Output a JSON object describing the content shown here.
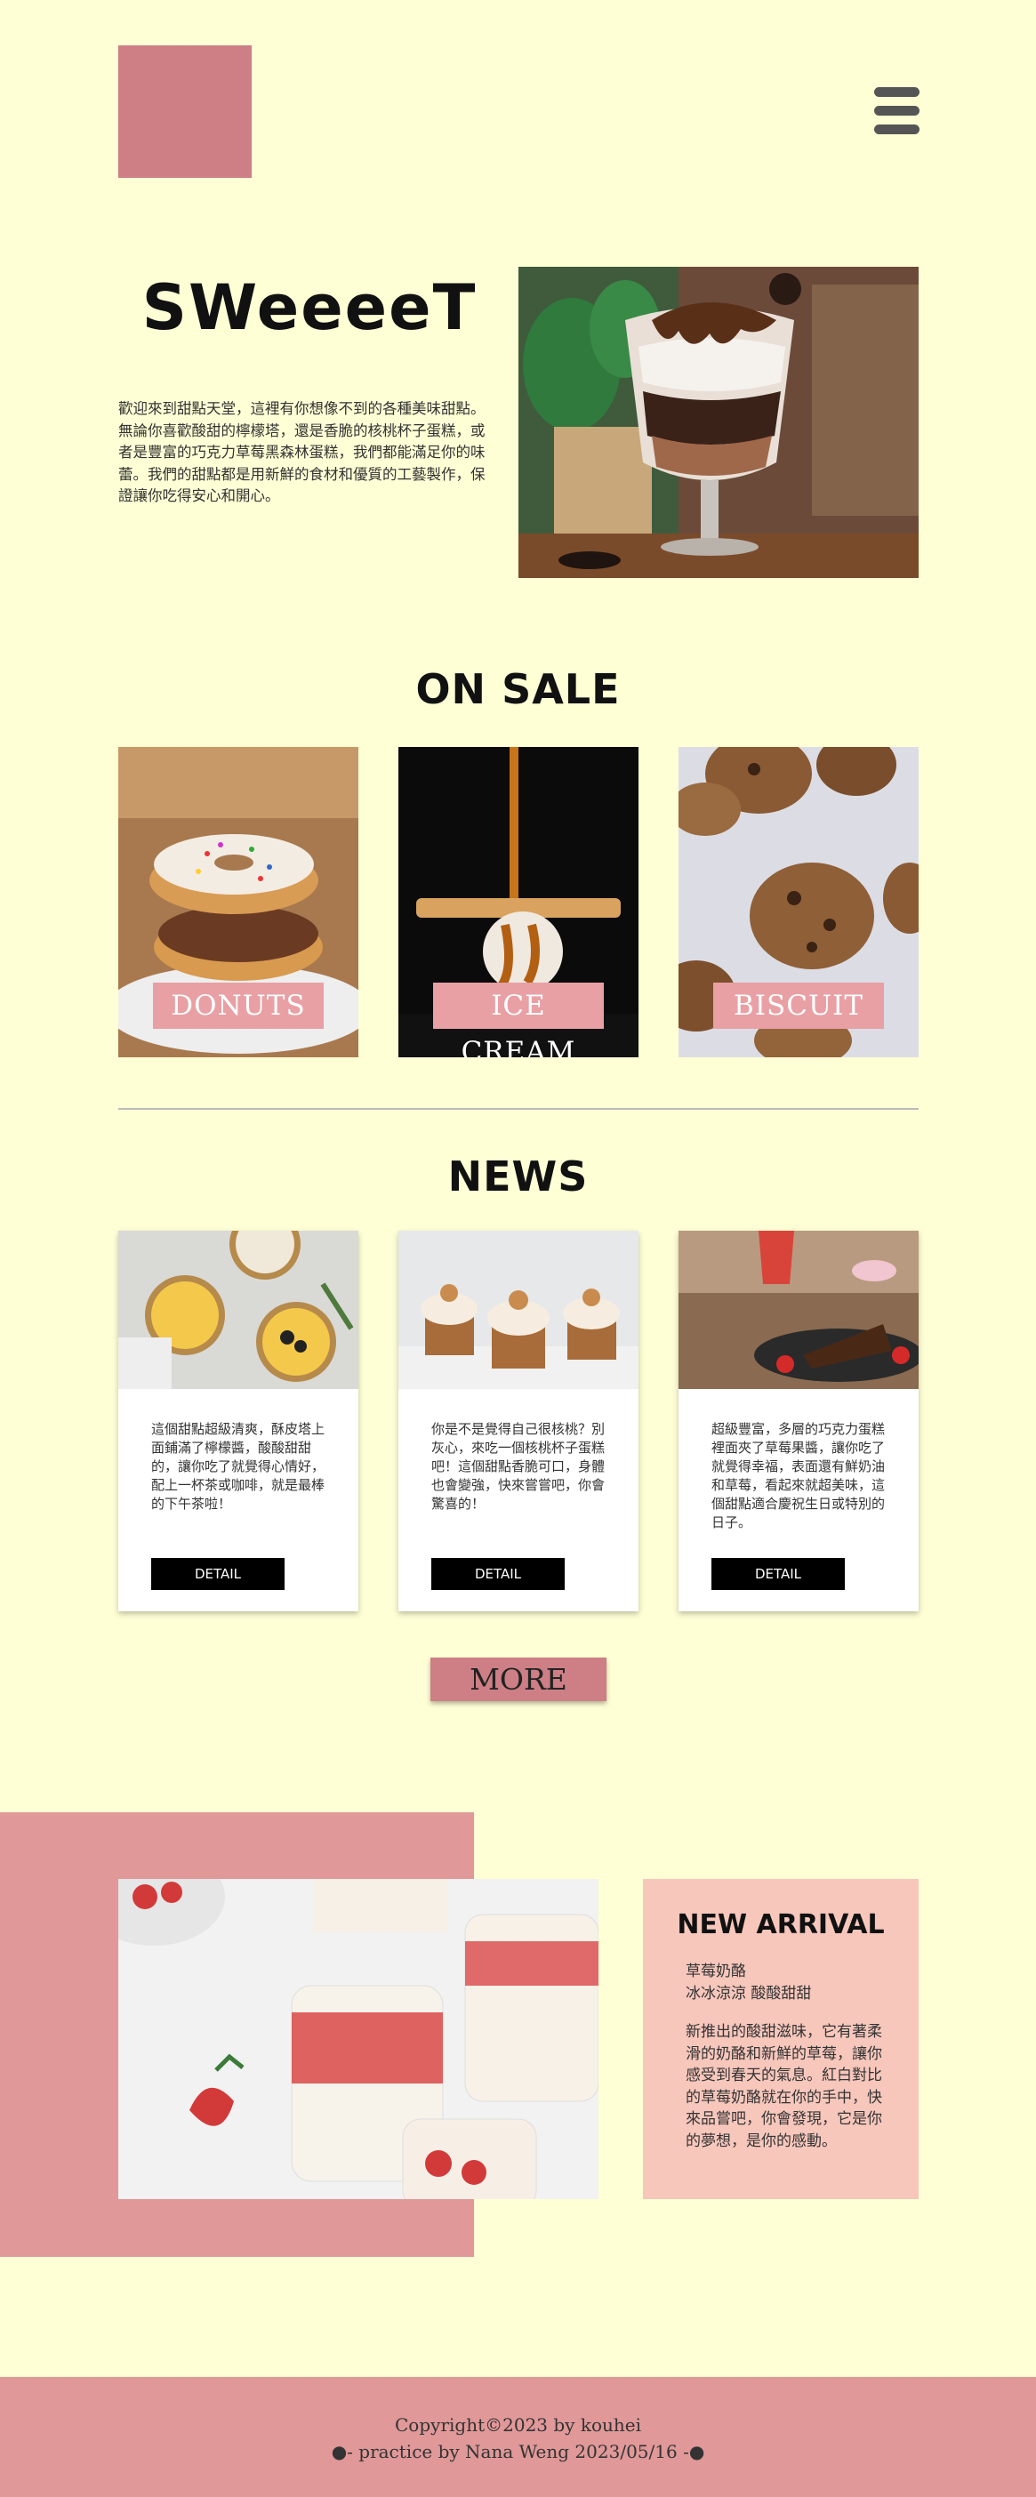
{
  "header": {
    "logo_alt": "",
    "menu_icon": "hamburger-menu-icon"
  },
  "hero": {
    "title": "SWeeeeT",
    "text": "歡迎來到甜點天堂，這裡有你想像不到的各種美味甜點。無論你喜歡酸甜的檸檬塔，還是香脆的核桃杯子蛋糕，或者是豐富的巧克力草莓黑森林蛋糕，我們都能滿足你的味蕾。我們的甜點都是用新鮮的食材和優質的工藝製作，保證讓你吃得安心和開心。"
  },
  "sale": {
    "title": "ON SALE",
    "items": [
      {
        "label": "DONUTS"
      },
      {
        "label": "ICE CREAM"
      },
      {
        "label": "BISCUIT"
      }
    ]
  },
  "news": {
    "title": "NEWS",
    "items": [
      {
        "text": "這個甜點超級清爽，酥皮塔上面鋪滿了檸檬醬，酸酸甜甜的，讓你吃了就覺得心情好，配上一杯茶或咖啡，就是最棒的下午茶啦！",
        "button": "DETAIL"
      },
      {
        "text": "你是不是覺得自己很核桃？別灰心，來吃一個核桃杯子蛋糕吧！這個甜點香脆可口，身體也會變強，快來嘗嘗吧，你會驚喜的！",
        "button": "DETAIL"
      },
      {
        "text": "超級豐富，多層的巧克力蛋糕裡面夾了草莓果醬，讓你吃了就覺得幸福，表面還有鮮奶油和草莓，看起來就超美味，這個甜點適合慶祝生日或特別的日子。",
        "button": "DETAIL"
      }
    ],
    "more_button": "MORE"
  },
  "arrival": {
    "title": "NEW ARRIVAL",
    "subtitle_1": "草莓奶酪",
    "subtitle_2": "冰冰涼涼 酸酸甜甜",
    "description": "新推出的酸甜滋味，它有著柔滑的奶酪和新鮮的草莓，讓你感受到春天的氣息。紅白對比的草莓奶酪就在你的手中，快來品嘗吧，你會發現，它是你的夢想，是你的感動。"
  },
  "footer": {
    "copyright": "Copyright©2023 by kouhei",
    "credit": "●- practice by Nana Weng 2023/05/16 -●"
  },
  "colors": {
    "background": "#ffffd6",
    "brand_pink": "#cd7f85",
    "label_pink": "#e8a0a4",
    "arrival_box": "#f7c7bc",
    "footer": "#e09898"
  }
}
